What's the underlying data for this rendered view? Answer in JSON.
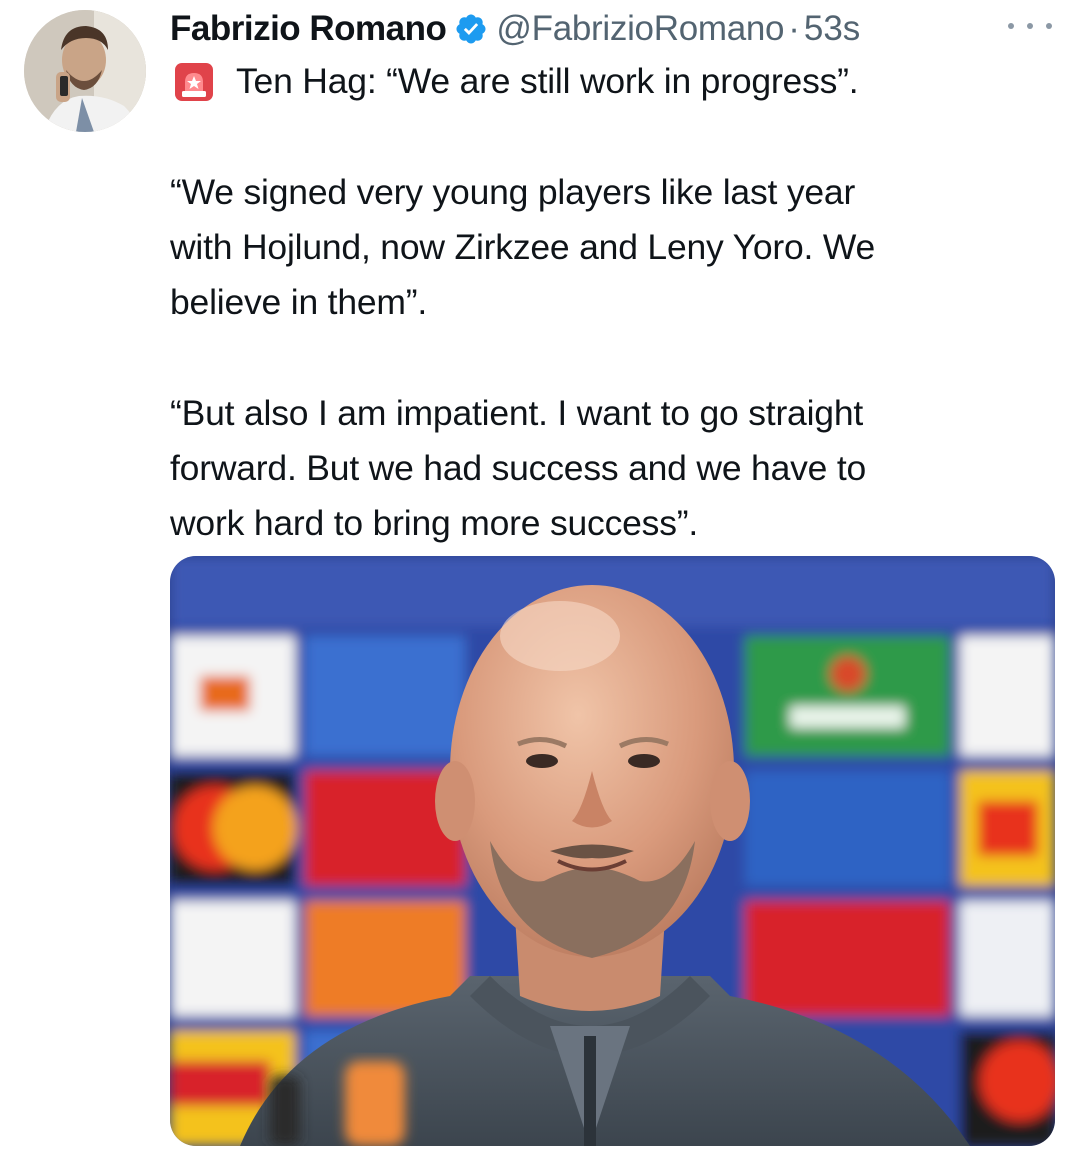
{
  "tweet": {
    "author": {
      "display_name": "Fabrizio Romano",
      "handle": "@FabrizioRomano",
      "verified": true,
      "avatar_icon": "profile-photo"
    },
    "separator": "·",
    "time": "53s",
    "more_icon": "ellipsis-icon",
    "text": {
      "headline": "Ten Hag: “We are still work in progress”.",
      "headline_icon": "rotating-light-emoji",
      "paragraph_2": [
        "“We signed very young players like last year",
        "with Hojlund, now Zirkzee and Leny Yoro. We",
        "believe in them”."
      ],
      "paragraph_3": [
        "“But also I am impatient. I want to go straight",
        "forward. But we had success and we have to",
        "work hard to bring more success”."
      ]
    },
    "media": {
      "type": "photo",
      "description_icon": "press-conference-photo"
    },
    "colors": {
      "text": "#0f1419",
      "secondary": "#536471",
      "verified_badge": "#1d9bf0"
    }
  }
}
